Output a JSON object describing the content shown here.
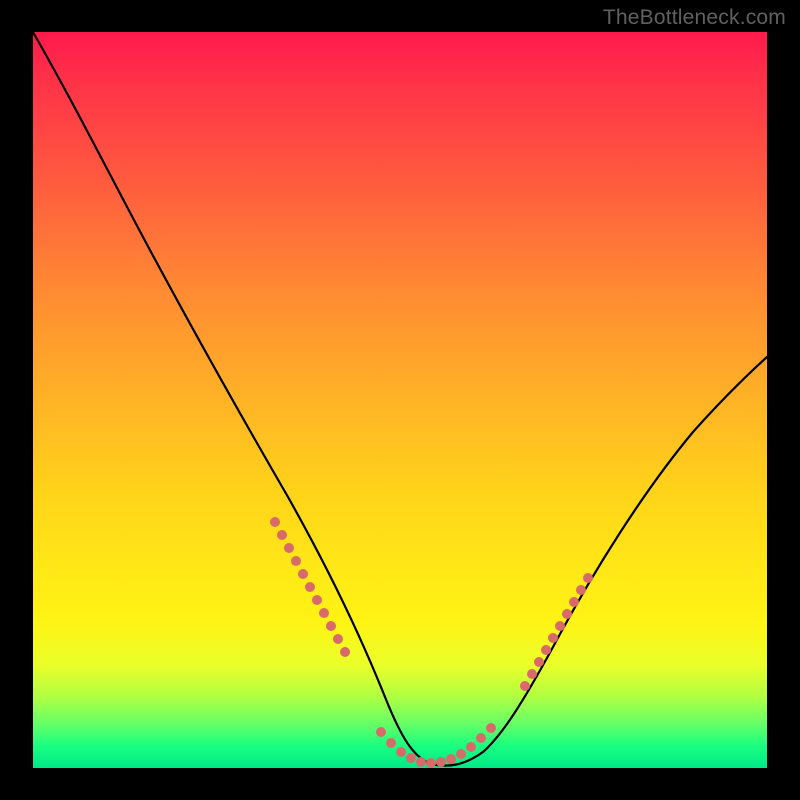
{
  "watermark": "TheBottleneck.com",
  "colors": {
    "background": "#000000",
    "curve": "#000000",
    "dots": "#d96a6a",
    "gradient_top": "#ff1a4d",
    "gradient_bottom": "#00e888"
  },
  "chart_data": {
    "type": "line",
    "title": "",
    "xlabel": "",
    "ylabel": "",
    "xlim": [
      0,
      100
    ],
    "ylim": [
      0,
      100
    ],
    "grid": false,
    "legend": false,
    "note": "V-shaped curve on rainbow gradient. y≈0 at minimum. No axis ticks labeled; values estimated from pixel position.",
    "series": [
      {
        "name": "curve",
        "x": [
          0,
          4,
          8,
          12,
          16,
          20,
          24,
          28,
          32,
          36,
          40,
          44,
          46,
          48,
          50,
          52,
          54,
          56,
          58,
          60,
          62,
          64,
          68,
          72,
          76,
          80,
          84,
          88,
          92,
          96,
          100
        ],
        "y": [
          100,
          94,
          87,
          80,
          73,
          66,
          59,
          51,
          44,
          36,
          28,
          19,
          14,
          9,
          5,
          2,
          1,
          0,
          0,
          1,
          3,
          6,
          13,
          20,
          27,
          33,
          39,
          44,
          48,
          52,
          55
        ]
      }
    ],
    "dot_clusters": {
      "note": "Salmon dotted segments overlaying parts of the curve near the valley",
      "clusters": [
        {
          "name": "left-descent",
          "x_range": [
            33,
            41
          ],
          "approx_y_range": [
            34,
            16
          ]
        },
        {
          "name": "valley-floor",
          "x_range": [
            47,
            63
          ],
          "approx_y_range": [
            6,
            6
          ]
        },
        {
          "name": "right-ascent",
          "x_range": [
            66,
            74
          ],
          "approx_y_range": [
            10,
            25
          ]
        }
      ]
    }
  }
}
